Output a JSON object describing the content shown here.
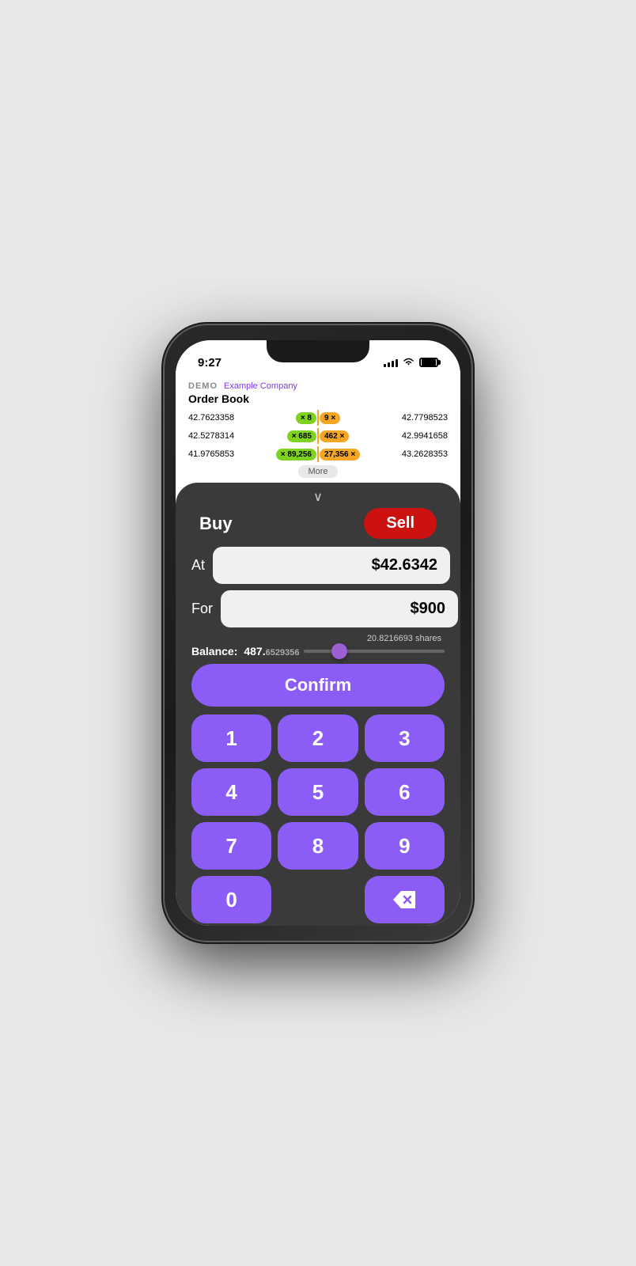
{
  "status_bar": {
    "time": "9:27"
  },
  "order_book": {
    "demo_label": "DEMO",
    "company_label": "Example Company",
    "title": "Order Book",
    "rows": [
      {
        "left_price": "42.7623358",
        "badge_green": "× 8",
        "badge_orange": "9 ×",
        "right_price": "42.7798523"
      },
      {
        "left_price": "42.5278314",
        "badge_green": "× 685",
        "badge_orange": "462 ×",
        "right_price": "42.9941658"
      },
      {
        "left_price": "41.9765853",
        "badge_green": "× 89,256",
        "badge_orange": "27,356 ×",
        "right_price": "43.2628353"
      }
    ],
    "more_button": "More"
  },
  "trading": {
    "chevron": "∨",
    "buy_label": "Buy",
    "sell_label": "Sell",
    "at_label": "At",
    "at_value": "$42.6342",
    "for_label": "For",
    "for_value": "$900",
    "shares_hint": "20.8216693 shares",
    "balance_label": "Balance:",
    "balance_integer": "487.",
    "balance_decimal": "6529356",
    "confirm_label": "Confirm",
    "numpad": [
      "1",
      "2",
      "3",
      "4",
      "5",
      "6",
      "7",
      "8",
      "9",
      "0",
      "⌫"
    ]
  }
}
